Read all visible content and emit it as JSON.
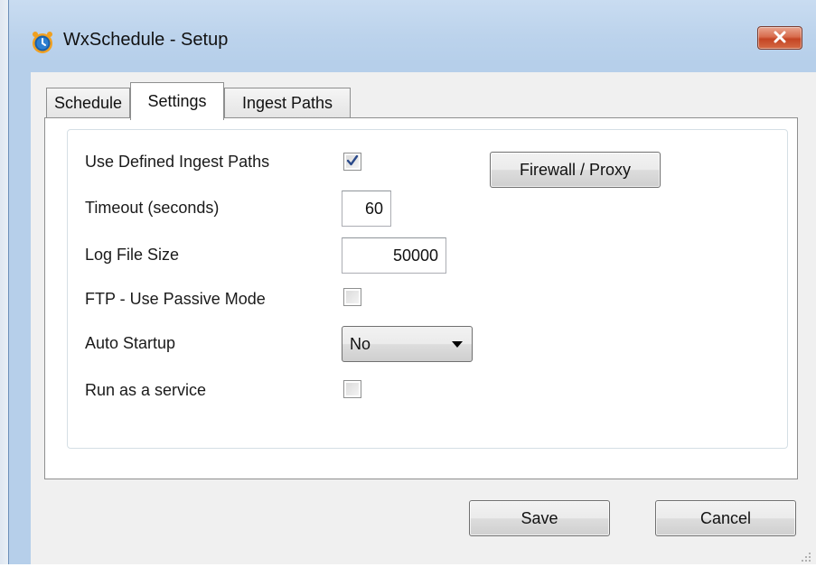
{
  "window": {
    "title": "WxSchedule - Setup",
    "icon": "alarm-clock-icon",
    "close_icon": "close-icon"
  },
  "tabs": [
    {
      "label": "Schedule",
      "active": false
    },
    {
      "label": "Settings",
      "active": true
    },
    {
      "label": "Ingest Paths",
      "active": false
    }
  ],
  "settings": {
    "use_defined_ingest_paths": {
      "label": "Use Defined Ingest Paths",
      "checked": true
    },
    "timeout": {
      "label": "Timeout (seconds)",
      "value": "60"
    },
    "log_file_size": {
      "label": "Log File Size",
      "value": "50000"
    },
    "ftp_passive": {
      "label": "FTP - Use Passive Mode",
      "checked": false
    },
    "auto_startup": {
      "label": "Auto Startup",
      "selected": "No"
    },
    "run_as_service": {
      "label": "Run as a service",
      "checked": false
    },
    "firewall_proxy_button": "Firewall / Proxy"
  },
  "footer": {
    "save_label": "Save",
    "cancel_label": "Cancel"
  },
  "colors": {
    "titlebar": "#bcd3ec",
    "close_button": "#c44524",
    "client_background": "#f0f0f0",
    "focused_button": "#bee6fd"
  }
}
